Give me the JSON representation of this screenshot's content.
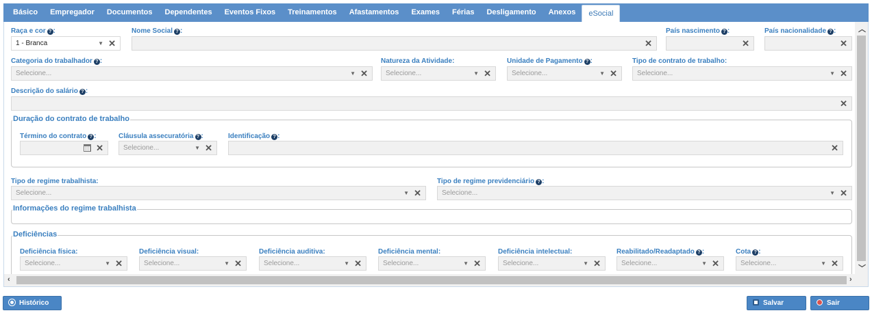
{
  "tabs": [
    "Básico",
    "Empregador",
    "Documentos",
    "Dependentes",
    "Eventos Fixos",
    "Treinamentos",
    "Afastamentos",
    "Exames",
    "Férias",
    "Desligamento",
    "Anexos",
    "eSocial"
  ],
  "active_tab": "eSocial",
  "fields": {
    "raca_cor": {
      "label": "Raça e cor",
      "value": "1 - Branca"
    },
    "nome_social": {
      "label": "Nome Social",
      "value": ""
    },
    "pais_nascimento": {
      "label": "País nascimento",
      "value": ""
    },
    "pais_nacionalidade": {
      "label": "País nacionalidade",
      "value": ""
    },
    "categoria_trabalhador": {
      "label": "Categoria do trabalhador",
      "placeholder": "Selecione..."
    },
    "natureza_atividade": {
      "label": "Natureza da Atividade:",
      "placeholder": "Selecione..."
    },
    "unidade_pagamento": {
      "label": "Unidade de Pagamento",
      "placeholder": "Selecione..."
    },
    "tipo_contrato": {
      "label": "Tipo de contrato de trabalho:",
      "placeholder": "Selecione..."
    },
    "descricao_salario": {
      "label": "Descrição do salário",
      "value": ""
    }
  },
  "duracao": {
    "legend": "Duração do contrato de trabalho",
    "termino": {
      "label": "Término do contrato",
      "value": ""
    },
    "clausula": {
      "label": "Cláusula assecuratória",
      "placeholder": "Selecione..."
    },
    "identificacao": {
      "label": "Identificação",
      "value": ""
    }
  },
  "regime": {
    "trabalhista": {
      "label": "Tipo de regime trabalhista:",
      "placeholder": "Selecione..."
    },
    "previdenciario": {
      "label": "Tipo de regime previdenciário",
      "placeholder": "Selecione..."
    }
  },
  "info_regime_legend": "Informações do regime trabalhista",
  "deficiencias": {
    "legend": "Deficiências",
    "items": [
      {
        "label": "Deficiência física:",
        "placeholder": "Selecione..."
      },
      {
        "label": "Deficiência visual:",
        "placeholder": "Selecione..."
      },
      {
        "label": "Deficiência auditiva:",
        "placeholder": "Selecione..."
      },
      {
        "label": "Deficiência mental:",
        "placeholder": "Selecione..."
      },
      {
        "label": "Deficiência intelectual:",
        "placeholder": "Selecione..."
      },
      {
        "label": "Reabilitado/Readaptado",
        "placeholder": "Selecione..."
      },
      {
        "label": "Cota",
        "placeholder": "Selecione..."
      }
    ]
  },
  "buttons": {
    "historico": "Histórico",
    "salvar": "Salvar",
    "sair": "Sair"
  },
  "symbols": {
    "help": "?",
    "clear": "✕",
    "dropdown": "▼",
    "colon": ":"
  },
  "colors": {
    "accent": "#4a86c5",
    "tabbar": "#5b8fc9",
    "label": "#3a7fbf"
  }
}
